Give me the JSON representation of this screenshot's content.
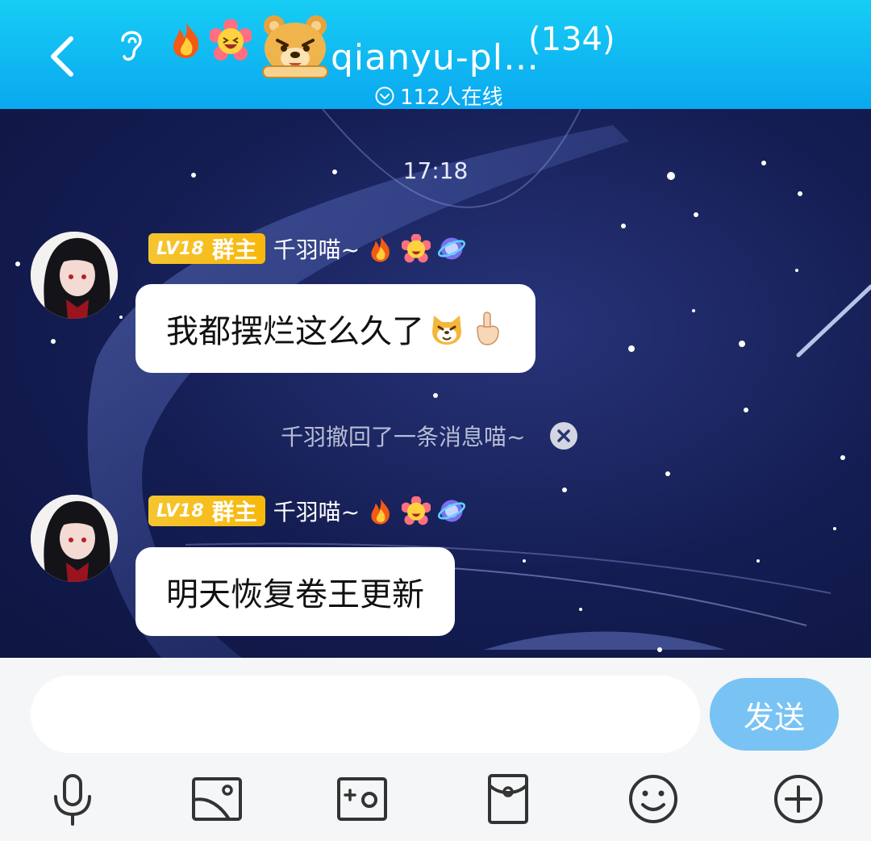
{
  "header": {
    "title": "qianyu-pl…",
    "member_count": "(134)",
    "online_text": "112人在线",
    "icons": [
      "back-arrow-icon",
      "ear-icon",
      "fire-badge-icon",
      "laughing-flower-icon",
      "angry-bear-sticker"
    ]
  },
  "chat": {
    "timestamp": "17:18",
    "messages": [
      {
        "level": "LV18",
        "role": "群主",
        "nickname": "千羽喵~",
        "text": "我都摆烂这么久了"
      },
      {
        "level": "LV18",
        "role": "群主",
        "nickname": "千羽喵~",
        "text": "明天恢复卷王更新"
      }
    ],
    "recall_notice": "千羽撤回了一条消息喵~"
  },
  "input_bar": {
    "placeholder": "",
    "send_label": "发送",
    "tools": [
      "microphone-icon",
      "image-icon",
      "camera-icon",
      "red-packet-icon",
      "emoji-icon",
      "plus-icon"
    ]
  },
  "colors": {
    "header": "#0aa8f0",
    "send": "#78c3f4",
    "level_badge": "#f5c531",
    "chat_bg": "#141d52"
  }
}
